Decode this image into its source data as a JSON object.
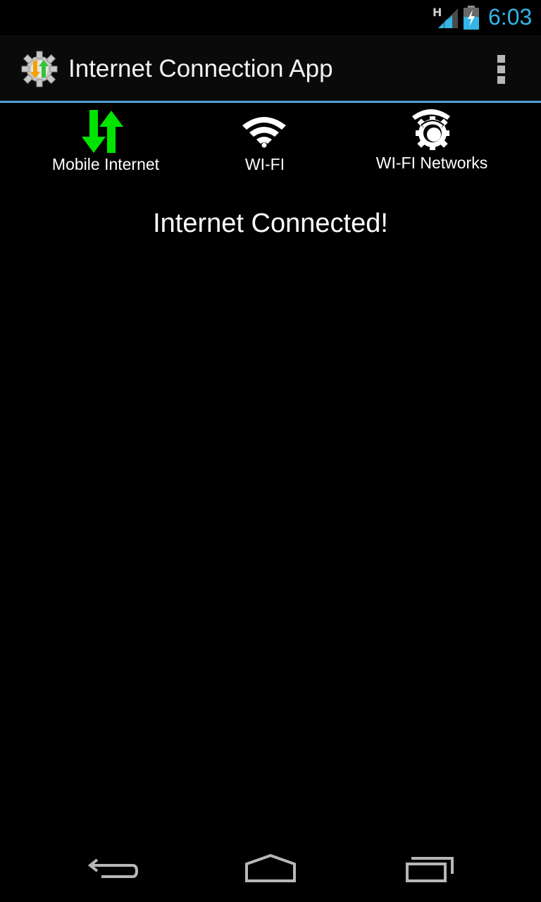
{
  "status_bar": {
    "network_type": "H",
    "time": "6:03",
    "accent_color": "#33b5e5"
  },
  "action_bar": {
    "title": "Internet Connection App",
    "app_icon": "gear-arrows-icon",
    "overflow_icon": "overflow-menu-icon",
    "divider_color": "#4fa3d9"
  },
  "tabs": [
    {
      "label": "Mobile Internet",
      "icon": "mobile-data-arrows-icon",
      "icon_color": "#00e400"
    },
    {
      "label": "WI-FI",
      "icon": "wifi-icon",
      "icon_color": "#ffffff"
    },
    {
      "label": "WI-FI Networks",
      "icon": "wifi-settings-icon",
      "icon_color": "#ffffff"
    }
  ],
  "main": {
    "message": "Internet Connected!"
  },
  "nav_bar": {
    "buttons": [
      "back-icon",
      "home-icon",
      "recent-apps-icon"
    ]
  }
}
